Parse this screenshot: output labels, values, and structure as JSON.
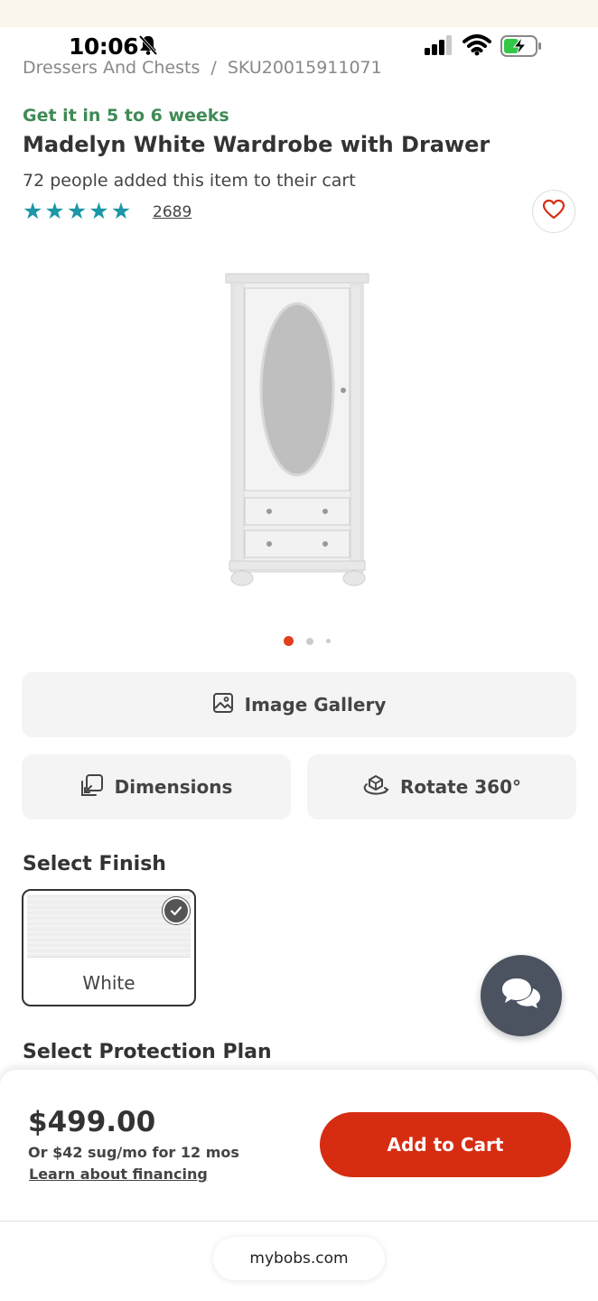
{
  "status_bar": {
    "time": "10:06"
  },
  "breadcrumb": {
    "category": "Dressers And Chests",
    "separator": "/",
    "sku": "SKU20015911071"
  },
  "product": {
    "delivery": "Get it in 5 to 6 weeks",
    "title": "Madelyn White Wardrobe with Drawer",
    "cart_count_text": "72 people added this item to their cart",
    "rating_stars": 5,
    "review_count": "2689"
  },
  "carousel": {
    "active_index": 0,
    "total": 3
  },
  "buttons": {
    "image_gallery": "Image Gallery",
    "dimensions": "Dimensions",
    "rotate": "Rotate 360°"
  },
  "finish": {
    "section_title": "Select Finish",
    "selected": "White"
  },
  "protection": {
    "section_title": "Select Protection Plan"
  },
  "purchase": {
    "price": "$499.00",
    "monthly": "Or $42 sug/mo for 12 mos",
    "financing_link": "Learn about financing",
    "add_to_cart": "Add to Cart"
  },
  "browser": {
    "url": "mybobs.com"
  },
  "colors": {
    "accent_red": "#d62d12",
    "delivery_green": "#3f8a55",
    "star_teal": "#1b97a6",
    "chat_bg": "#4b5260"
  }
}
